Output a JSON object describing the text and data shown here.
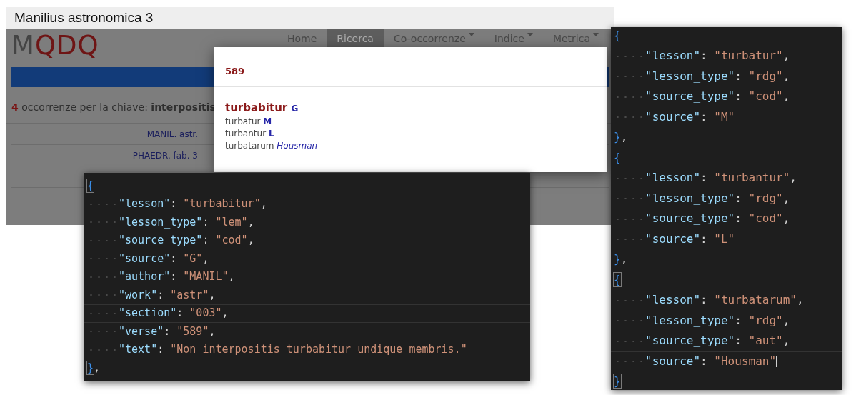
{
  "slide_title": "Manilius astronomica 3",
  "site": {
    "logo": [
      {
        "text": "M",
        "kind": "plain"
      },
      {
        "text": "QDQ",
        "kind": "accent"
      }
    ],
    "nav": [
      {
        "label": "Home",
        "selected": false,
        "dropdown": false
      },
      {
        "label": "Ricerca",
        "selected": true,
        "dropdown": false
      },
      {
        "label": "Co-occorrenze",
        "selected": false,
        "dropdown": true
      },
      {
        "label": "Indice",
        "selected": false,
        "dropdown": true
      },
      {
        "label": "Metrica",
        "selected": false,
        "dropdown": true
      }
    ],
    "result": {
      "count": "4",
      "text": "occorrenze per la chiave:",
      "key": "interpositis"
    },
    "rows": [
      {
        "ref": "MANIL. astr."
      },
      {
        "ref": "PHAEDR. fab. 3"
      },
      {},
      {}
    ]
  },
  "modal": {
    "title": "589",
    "readings": [
      {
        "lesson": "turbabitur",
        "source": "G",
        "kind": "lemma"
      },
      {
        "lesson": "turbatur",
        "source": "M",
        "kind": "cod"
      },
      {
        "lesson": "turbantur",
        "source": "L",
        "kind": "cod"
      },
      {
        "lesson": "turbatarum",
        "source": "Housman",
        "kind": "aut"
      }
    ]
  },
  "editors": [
    {
      "lines": [
        {
          "kind": "brace",
          "text": "{",
          "matched": true,
          "current": false,
          "cursor": false
        },
        {
          "kind": "pair",
          "key": "\"lesson\"",
          "colon": ":",
          "value": "\"turbabitur\"",
          "comma": ",",
          "current": false,
          "cursor": false
        },
        {
          "kind": "pair",
          "key": "\"lesson_type\"",
          "colon": ":",
          "value": "\"lem\"",
          "comma": ",",
          "current": false,
          "cursor": false
        },
        {
          "kind": "pair",
          "key": "\"source_type\"",
          "colon": ":",
          "value": "\"cod\"",
          "comma": ",",
          "current": false,
          "cursor": false
        },
        {
          "kind": "pair",
          "key": "\"source\"",
          "colon": ":",
          "value": "\"G\"",
          "comma": ",",
          "current": false,
          "cursor": false
        },
        {
          "kind": "pair",
          "key": "\"author\"",
          "colon": ":",
          "value": "\"MANIL\"",
          "comma": ",",
          "current": false,
          "cursor": false
        },
        {
          "kind": "pair",
          "key": "\"work\"",
          "colon": ":",
          "value": "\"astr\"",
          "comma": ",",
          "current": false,
          "cursor": false
        },
        {
          "kind": "pair",
          "key": "\"section\"",
          "colon": ":",
          "value": "\"003\"",
          "comma": ",",
          "current": true,
          "cursor": false
        },
        {
          "kind": "pair",
          "key": "\"verse\"",
          "colon": ":",
          "value": "\"589\"",
          "comma": ",",
          "current": false,
          "cursor": false
        },
        {
          "kind": "pair",
          "key": "\"text\"",
          "colon": ":",
          "value": "\"Non interpositis turbabitur undique membris.\"",
          "current": false,
          "cursor": false
        },
        {
          "kind": "brace",
          "text": "},",
          "matched": true,
          "current": false,
          "cursor": false
        }
      ]
    },
    {
      "lines": [
        {
          "kind": "brace",
          "text": "{",
          "matched": false,
          "current": false,
          "cursor": false
        },
        {
          "kind": "pair",
          "key": "\"lesson\"",
          "colon": ":",
          "value": "\"turbatur\"",
          "comma": ",",
          "current": false,
          "cursor": false
        },
        {
          "kind": "pair",
          "key": "\"lesson_type\"",
          "colon": ":",
          "value": "\"rdg\"",
          "comma": ",",
          "current": false,
          "cursor": false
        },
        {
          "kind": "pair",
          "key": "\"source_type\"",
          "colon": ":",
          "value": "\"cod\"",
          "comma": ",",
          "current": false,
          "cursor": false
        },
        {
          "kind": "pair",
          "key": "\"source\"",
          "colon": ":",
          "value": "\"M\"",
          "current": false,
          "cursor": false
        },
        {
          "kind": "brace",
          "text": "},",
          "matched": false,
          "current": false,
          "cursor": false
        },
        {
          "kind": "brace",
          "text": "{",
          "matched": false,
          "current": false,
          "cursor": false
        },
        {
          "kind": "pair",
          "key": "\"lesson\"",
          "colon": ":",
          "value": "\"turbantur\"",
          "comma": ",",
          "current": false,
          "cursor": false
        },
        {
          "kind": "pair",
          "key": "\"lesson_type\"",
          "colon": ":",
          "value": "\"rdg\"",
          "comma": ",",
          "current": false,
          "cursor": false
        },
        {
          "kind": "pair",
          "key": "\"source_type\"",
          "colon": ":",
          "value": "\"cod\"",
          "comma": ",",
          "current": false,
          "cursor": false
        },
        {
          "kind": "pair",
          "key": "\"source\"",
          "colon": ":",
          "value": "\"L\"",
          "current": false,
          "cursor": false
        },
        {
          "kind": "brace",
          "text": "},",
          "matched": false,
          "current": false,
          "cursor": false
        },
        {
          "kind": "brace",
          "text": "{",
          "matched": true,
          "current": false,
          "cursor": false
        },
        {
          "kind": "pair",
          "key": "\"lesson\"",
          "colon": ":",
          "value": "\"turbatarum\"",
          "comma": ",",
          "current": false,
          "cursor": false
        },
        {
          "kind": "pair",
          "key": "\"lesson_type\"",
          "colon": ":",
          "value": "\"rdg\"",
          "comma": ",",
          "current": false,
          "cursor": false
        },
        {
          "kind": "pair",
          "key": "\"source_type\"",
          "colon": ":",
          "value": "\"aut\"",
          "comma": ",",
          "current": false,
          "cursor": false
        },
        {
          "kind": "pair",
          "key": "\"source\"",
          "colon": ":",
          "value": "\"Housman\"",
          "current": true,
          "cursor": true
        },
        {
          "kind": "brace",
          "text": "}",
          "matched": true,
          "current": false,
          "cursor": false
        }
      ]
    }
  ]
}
